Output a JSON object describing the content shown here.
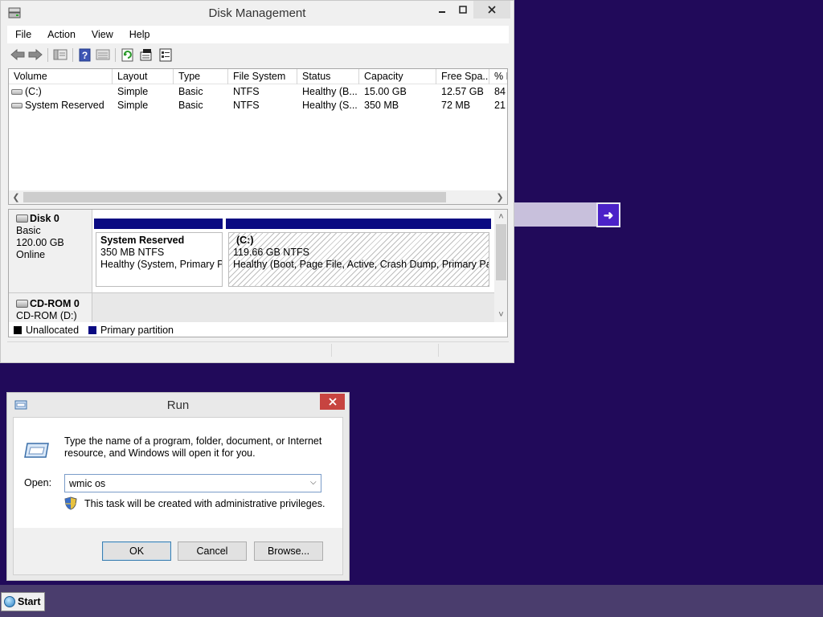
{
  "disk_management": {
    "title": "Disk Management",
    "menu": [
      "File",
      "Action",
      "View",
      "Help"
    ],
    "columns": [
      "Volume",
      "Layout",
      "Type",
      "File System",
      "Status",
      "Capacity",
      "Free Spa...",
      "% F"
    ],
    "volumes": [
      {
        "volume": "(C:)",
        "layout": "Simple",
        "type": "Basic",
        "fs": "NTFS",
        "status": "Healthy (B...",
        "capacity": "15.00 GB",
        "free": "12.57 GB",
        "pct": "84"
      },
      {
        "volume": "System Reserved",
        "layout": "Simple",
        "type": "Basic",
        "fs": "NTFS",
        "status": "Healthy (S...",
        "capacity": "350 MB",
        "free": "72 MB",
        "pct": "21"
      }
    ],
    "disk0": {
      "name": "Disk 0",
      "type": "Basic",
      "size": "120.00 GB",
      "state": "Online"
    },
    "partitions": [
      {
        "name": "System Reserved",
        "size": "350 MB NTFS",
        "status": "Healthy (System, Primary Pa"
      },
      {
        "name": "(C:)",
        "size": "119.66 GB NTFS",
        "status": "Healthy (Boot, Page File, Active, Crash Dump, Primary Partit"
      }
    ],
    "cdrom0": {
      "name": "CD-ROM 0",
      "label": "CD-ROM (D:)"
    },
    "legend": {
      "unallocated": "Unallocated",
      "primary": "Primary partition"
    },
    "colors": {
      "primary_partition": "#0a0a82",
      "unallocated": "#000000"
    }
  },
  "run_dialog": {
    "title": "Run",
    "description": "Type the name of a program, folder, document, or Internet resource, and Windows will open it for you.",
    "open_label": "Open:",
    "open_value": "wmic os",
    "admin_note": "This task will be created with administrative privileges.",
    "ok_label": "OK",
    "cancel_label": "Cancel",
    "browse_label": "Browse..."
  },
  "taskbar": {
    "start_label": "Start"
  },
  "colors": {
    "desktop": "#210a5a",
    "taskbar": "#4a3d6d",
    "close_red": "#c74440"
  }
}
